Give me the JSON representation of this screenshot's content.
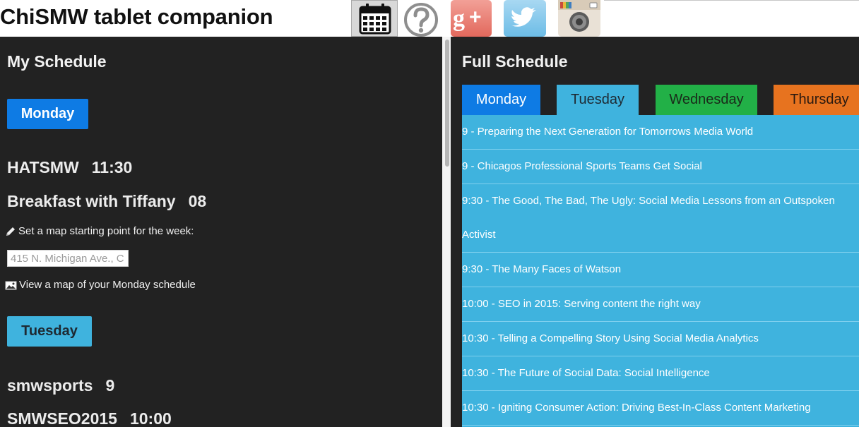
{
  "app": {
    "title": "ChiSMW tablet companion",
    "toolbar": [
      {
        "name": "calendar-icon",
        "active": true
      },
      {
        "name": "help-icon"
      },
      {
        "name": "google-plus-icon",
        "label": "g+"
      },
      {
        "name": "twitter-icon"
      },
      {
        "name": "instagram-icon"
      }
    ]
  },
  "colors": {
    "panel_bg": "#222222",
    "monday": "#0e7be4",
    "tuesday": "#3fb3de",
    "wednesday": "#22b047",
    "thursday": "#e7731f"
  },
  "my_schedule": {
    "heading": "My Schedule",
    "days": [
      {
        "label": "Monday",
        "items": [
          {
            "name": "HATSMW",
            "time": "11:30"
          },
          {
            "name": "Breakfast with Tiffany",
            "time": "08"
          }
        ],
        "map_start_label": "Set a map starting point for the week:",
        "map_start_value": "415 N. Michigan Ave., C",
        "view_map_label": "View a map of your Monday schedule"
      },
      {
        "label": "Tuesday",
        "items": [
          {
            "name": "smwsports",
            "time": "9"
          },
          {
            "name": "SMWSEO2015",
            "time": "10:00"
          }
        ]
      }
    ]
  },
  "full_schedule": {
    "heading": "Full Schedule",
    "tabs": [
      "Monday",
      "Tuesday",
      "Wednesday",
      "Thursday"
    ],
    "selected_tab": "Tuesday",
    "sessions": [
      "9 - Preparing the Next Generation for Tomorrows Media World",
      "9 - Chicagos Professional Sports Teams Get Social",
      "9:30 - The Good, The Bad, The Ugly: Social Media Lessons from an Outspoken",
      "Activist",
      "9:30 - The Many Faces of Watson",
      "10:00 - SEO in 2015: Serving content the right way",
      "10:30 - Telling a Compelling Story Using Social Media Analytics",
      "10:30 - The Future of Social Data: Social Intelligence",
      "10:30 - Igniting Consumer Action: Driving Best-In-Class Content Marketing"
    ]
  }
}
